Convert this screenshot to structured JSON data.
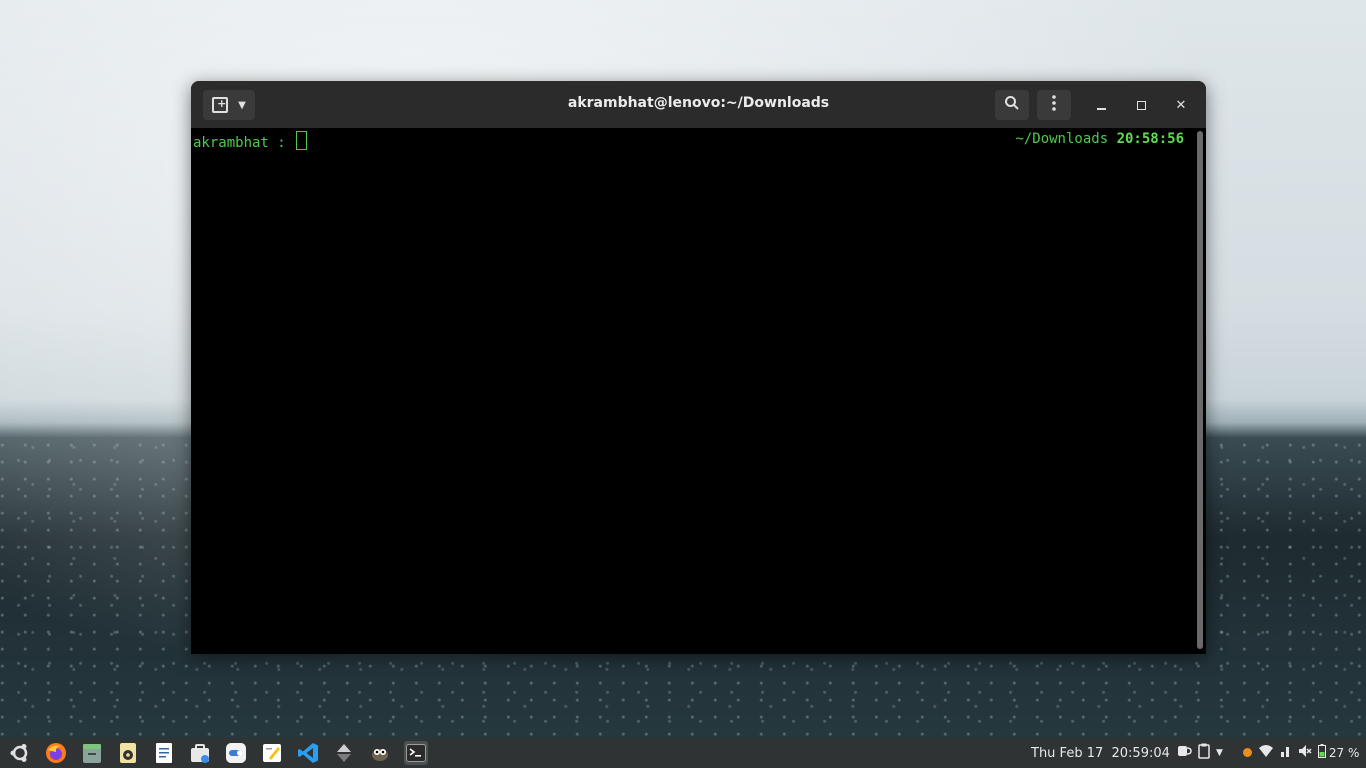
{
  "window": {
    "title": "akrambhat@lenovo:~/Downloads"
  },
  "terminal": {
    "prompt_user": "akrambhat",
    "prompt_sep": " : ",
    "right_path": "~/Downloads",
    "right_time": "20:58:56",
    "colors": {
      "fg": "#4ec94e",
      "bg": "#000000"
    }
  },
  "taskbar": {
    "apps": [
      "ubuntu-menu-icon",
      "firefox-icon",
      "files-icon",
      "disk-icon",
      "text-editor-icon",
      "software-icon",
      "toggle-icon",
      "notes-icon",
      "vscode-icon",
      "transfer-icon",
      "gimp-icon",
      "terminal-icon"
    ],
    "clock": "Thu Feb 17  20:59:04",
    "battery": "27 %"
  }
}
